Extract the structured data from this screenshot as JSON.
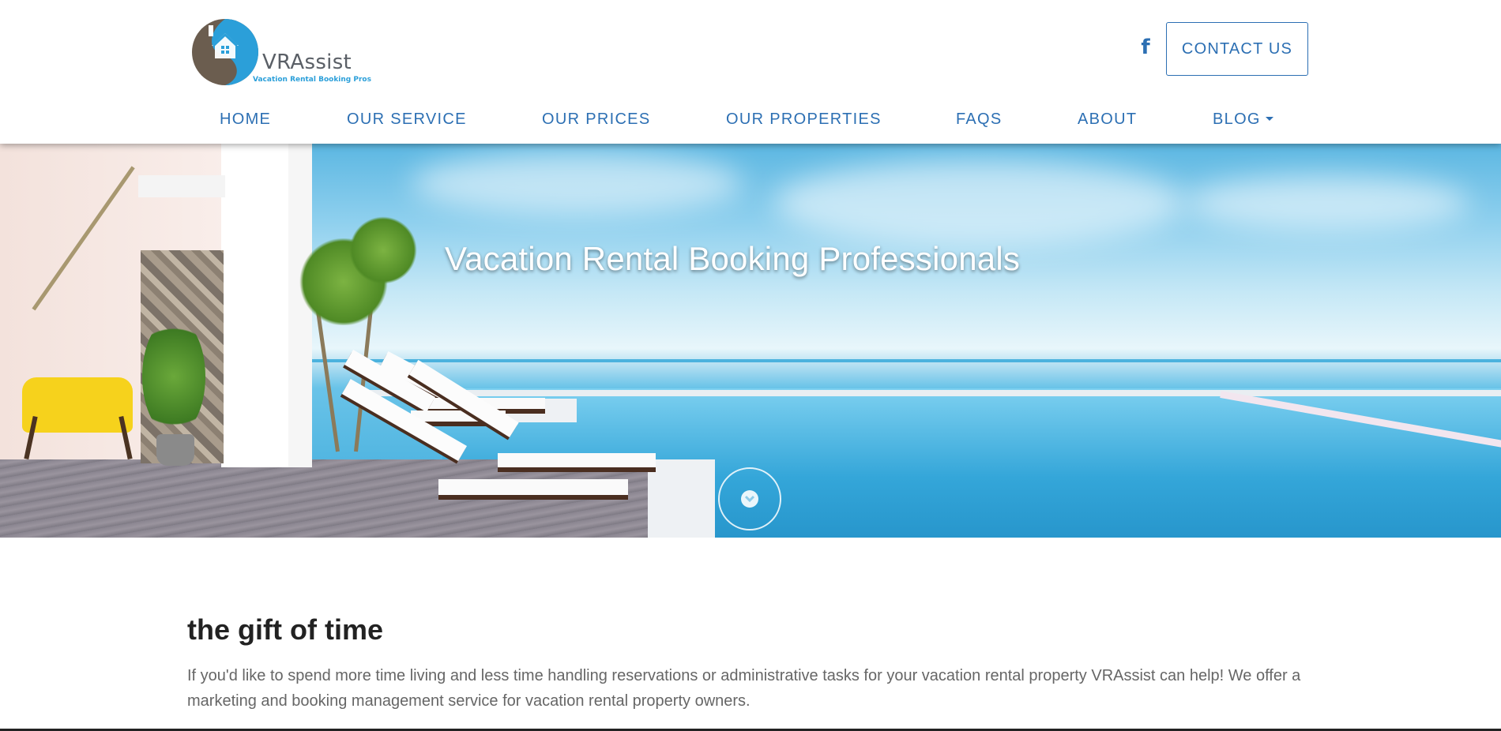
{
  "brand": {
    "name": "VRAssist",
    "tagline": "Vacation Rental Booking Pros",
    "colors": {
      "primary": "#2c6fb3",
      "logo_blue": "#2b9fd9",
      "logo_brown": "#6b5d4f"
    }
  },
  "header": {
    "social_icon": "facebook-icon",
    "contact_label": "CONTACT US"
  },
  "nav": {
    "items": [
      {
        "label": "HOME"
      },
      {
        "label": "OUR SERVICE"
      },
      {
        "label": "OUR PRICES"
      },
      {
        "label": "OUR PROPERTIES"
      },
      {
        "label": "FAQS"
      },
      {
        "label": "ABOUT"
      },
      {
        "label": "BLOG"
      }
    ]
  },
  "hero": {
    "title": "Vacation Rental Booking Professionals",
    "scroll_icon": "chevron-down-icon"
  },
  "intro": {
    "heading": "the gift of time",
    "body": "If you'd like to spend more time living and less time handling reservations or administrative tasks for your vacation rental property VRAssist can help! We offer a marketing and booking management service for vacation rental property owners."
  }
}
